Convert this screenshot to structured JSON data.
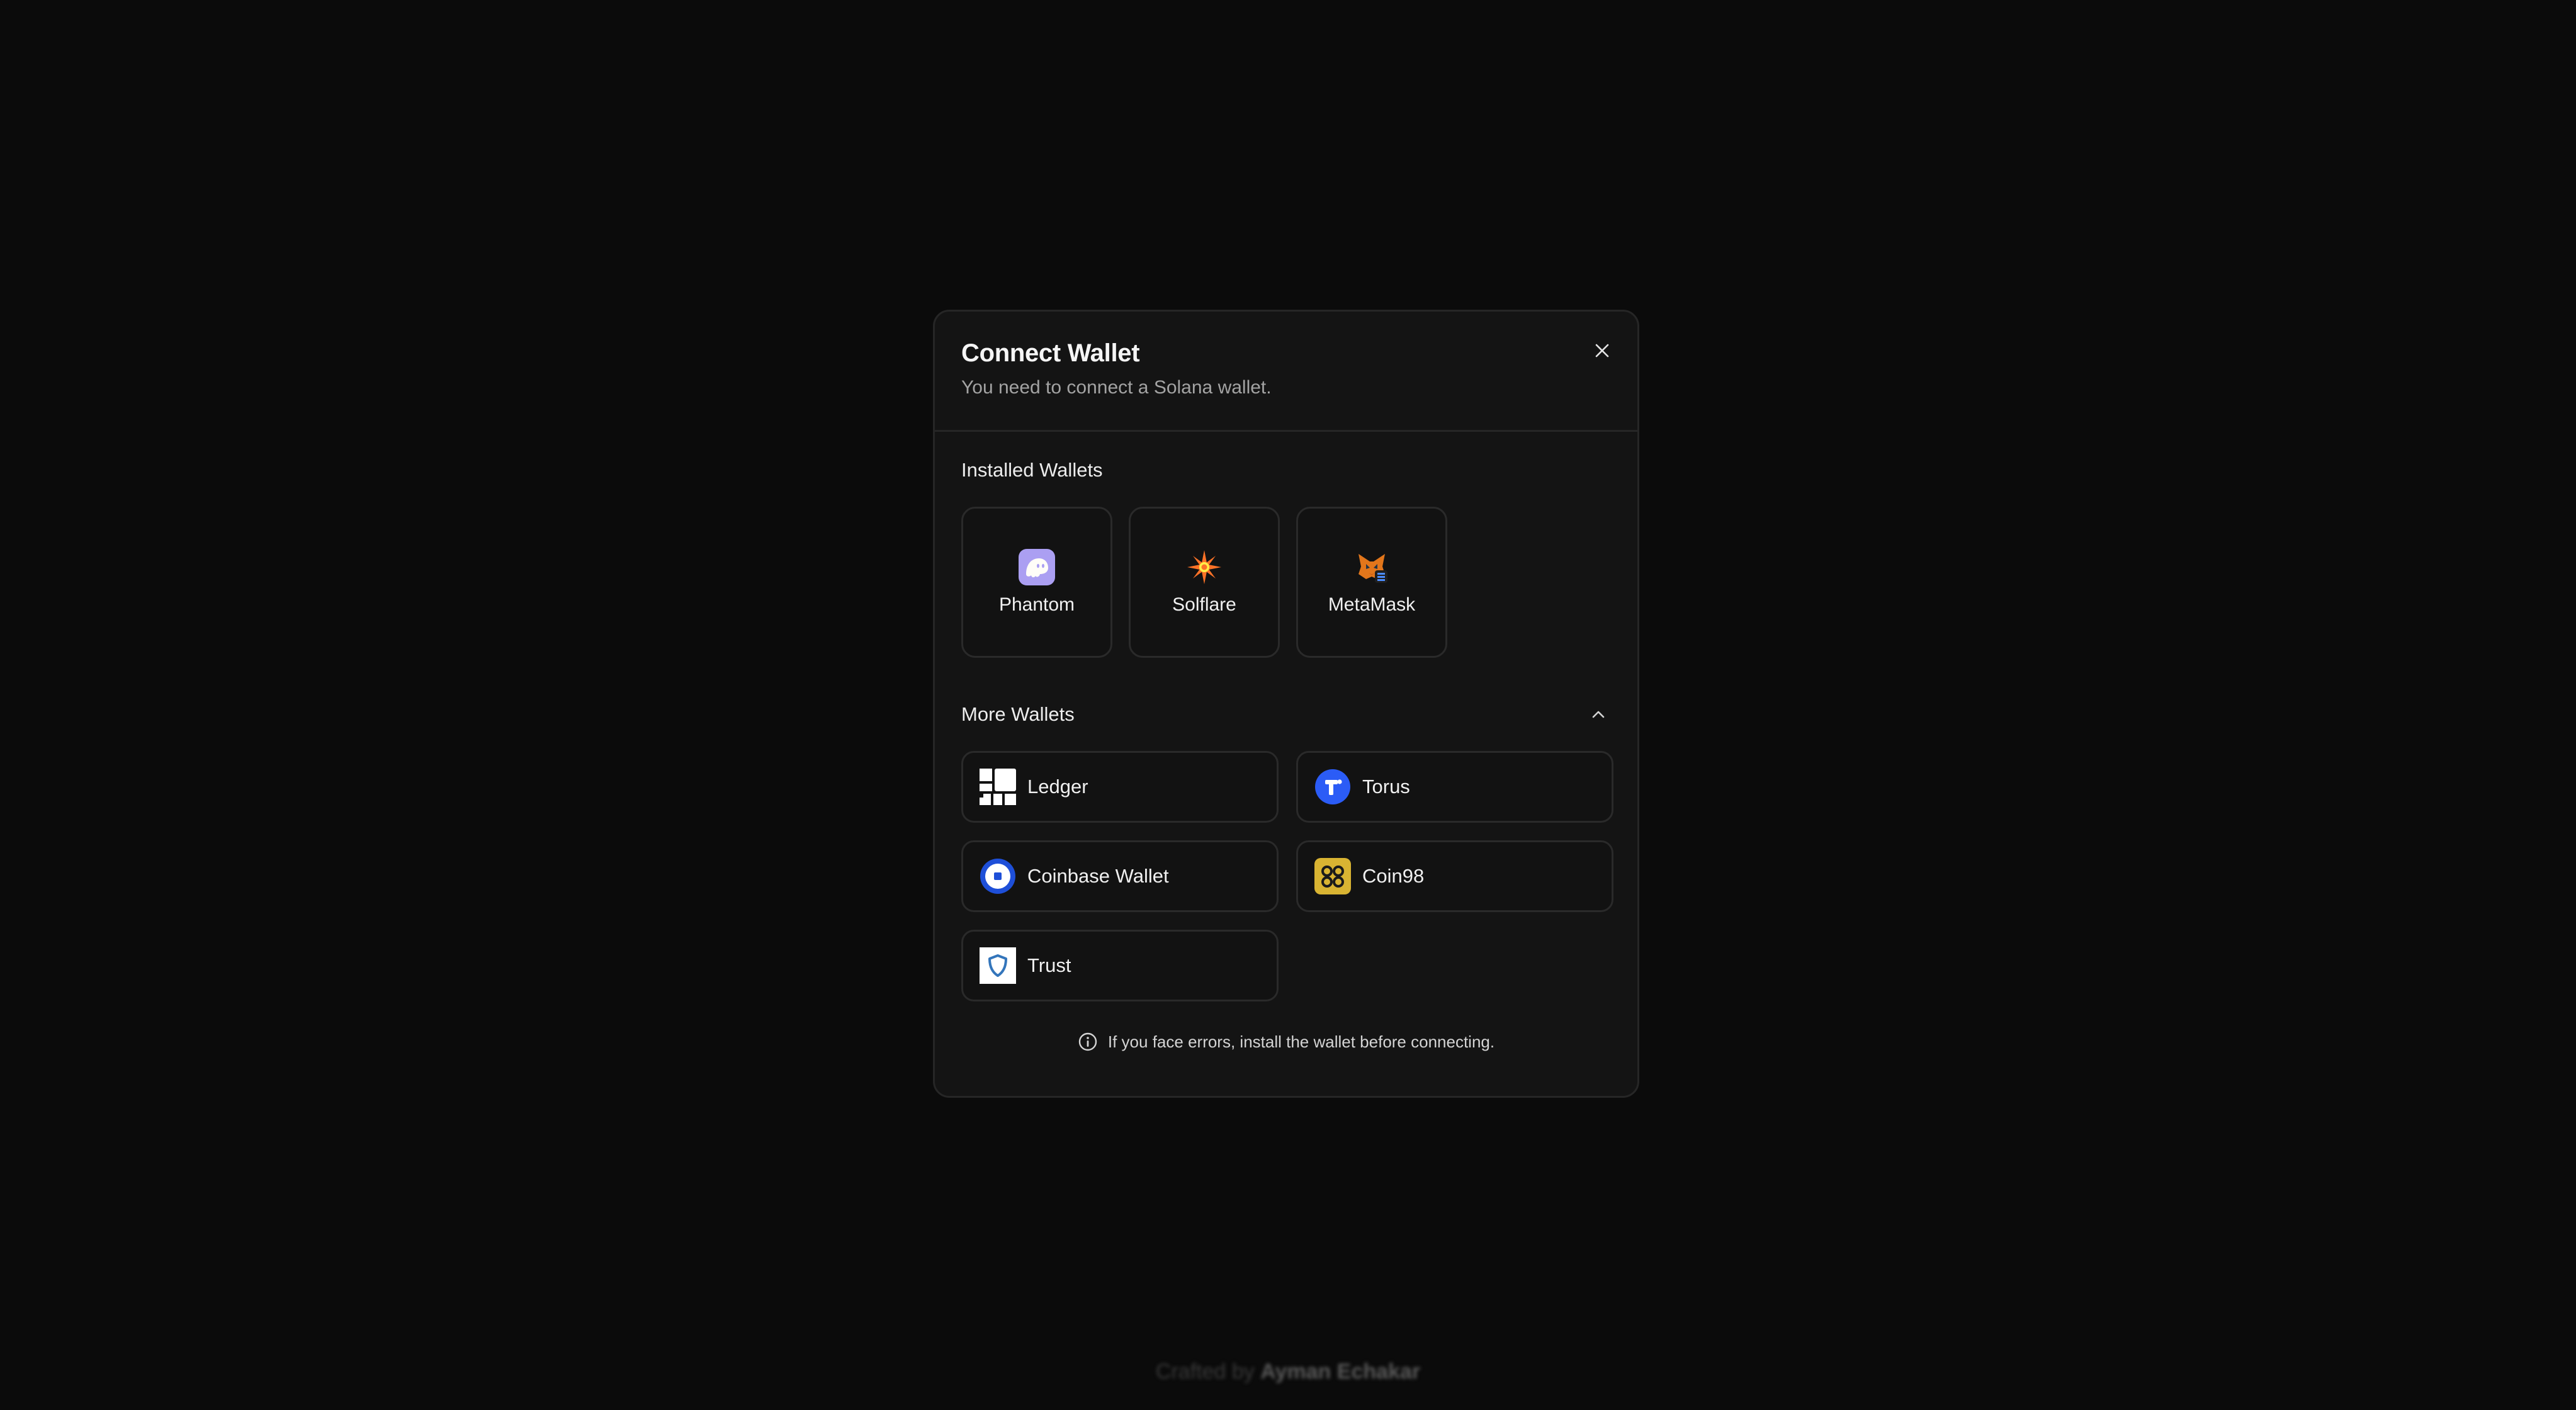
{
  "modal": {
    "title": "Connect Wallet",
    "subtitle": "You need to connect a Solana wallet.",
    "close_icon": "close-icon"
  },
  "installed": {
    "label": "Installed Wallets",
    "wallets": [
      {
        "label": "Phantom",
        "icon": "phantom-icon",
        "color": "#ab9ff2"
      },
      {
        "label": "Solflare",
        "icon": "solflare-icon",
        "color": "#fc7227"
      },
      {
        "label": "MetaMask",
        "icon": "metamask-icon",
        "color": "#e2761b"
      }
    ]
  },
  "more": {
    "label": "More Wallets",
    "toggle_icon": "chevron-up-icon",
    "wallets": [
      {
        "label": "Ledger",
        "icon": "ledger-icon",
        "color": "#ffffff"
      },
      {
        "label": "Torus",
        "icon": "torus-icon",
        "color": "#0364ff"
      },
      {
        "label": "Coinbase Wallet",
        "icon": "coinbase-icon",
        "color": "#0052ff"
      },
      {
        "label": "Coin98",
        "icon": "coin98-icon",
        "color": "#d9b432"
      },
      {
        "label": "Trust",
        "icon": "trust-icon",
        "color": "#3375bb"
      }
    ]
  },
  "footer": {
    "note": "If you face errors, install the wallet before connecting.",
    "icon": "info-icon"
  },
  "credits": {
    "prefix": "Crafted by",
    "author": "Ayman Echakar"
  }
}
